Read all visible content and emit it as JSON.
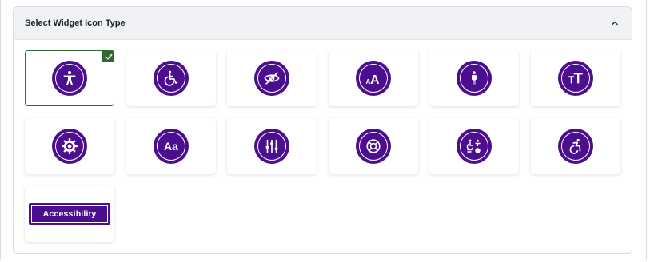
{
  "panel": {
    "title": "Select Widget Icon Type",
    "expanded": true
  },
  "colors": {
    "icon_purple": "#4a0e8f",
    "selected_green": "#2f6b32"
  },
  "icons": [
    {
      "name": "accessibility-person-icon",
      "selected": true
    },
    {
      "name": "wheelchair-icon",
      "selected": false
    },
    {
      "name": "eye-slash-icon",
      "selected": false
    },
    {
      "name": "font-size-icon",
      "selected": false
    },
    {
      "name": "standing-person-icon",
      "selected": false
    },
    {
      "name": "text-size-icon",
      "selected": false
    },
    {
      "name": "gear-icon",
      "selected": false
    },
    {
      "name": "typography-icon",
      "selected": false,
      "text": "Aa"
    },
    {
      "name": "sliders-icon",
      "selected": false
    },
    {
      "name": "lifebuoy-icon",
      "selected": false
    },
    {
      "name": "accessibility-symbols-icon",
      "selected": false
    },
    {
      "name": "active-wheelchair-icon",
      "selected": false
    },
    {
      "name": "accessibility-text-badge",
      "selected": false,
      "text": "Accessibility"
    }
  ]
}
